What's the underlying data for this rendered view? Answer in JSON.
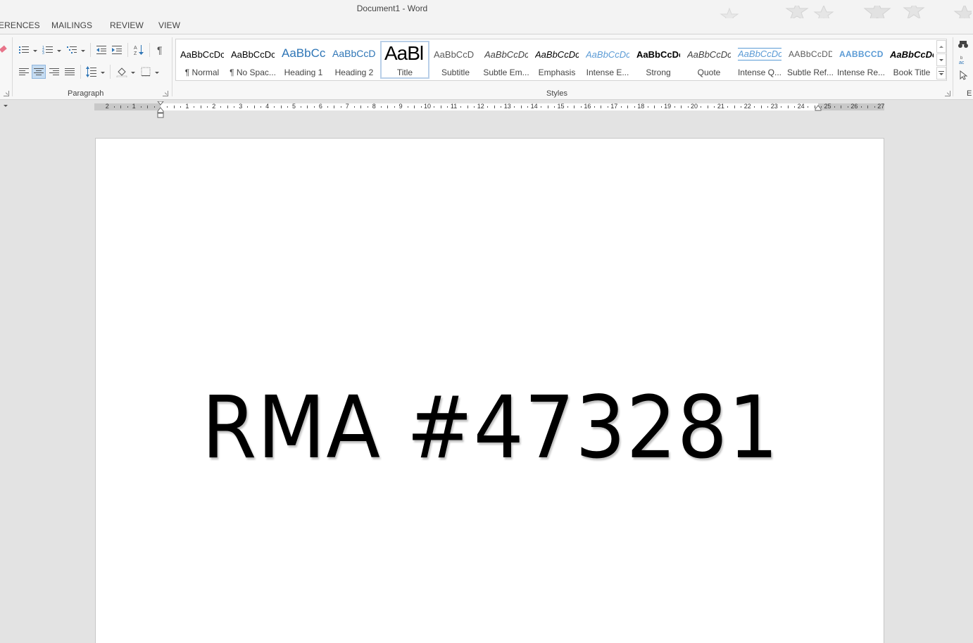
{
  "window": {
    "title": "Document1 - Word"
  },
  "tabs": [
    {
      "label": "ERENCES"
    },
    {
      "label": "MAILINGS"
    },
    {
      "label": "REVIEW"
    },
    {
      "label": "VIEW"
    }
  ],
  "ribbon": {
    "paragraph_group": {
      "label": "Paragraph"
    },
    "styles_group": {
      "label": "Styles",
      "items": [
        {
          "sample": "AaBbCcDc",
          "name": "¶ Normal"
        },
        {
          "sample": "AaBbCcDc",
          "name": "¶ No Spac..."
        },
        {
          "sample": "AaBbCc",
          "name": "Heading 1"
        },
        {
          "sample": "AaBbCcD",
          "name": "Heading 2"
        },
        {
          "sample": "AaBl",
          "name": "Title"
        },
        {
          "sample": "AaBbCcD",
          "name": "Subtitle"
        },
        {
          "sample": "AaBbCcDc",
          "name": "Subtle Em..."
        },
        {
          "sample": "AaBbCcDc",
          "name": "Emphasis"
        },
        {
          "sample": "AaBbCcDc",
          "name": "Intense E..."
        },
        {
          "sample": "AaBbCcDc",
          "name": "Strong"
        },
        {
          "sample": "AaBbCcDc",
          "name": "Quote"
        },
        {
          "sample": "AaBbCcDc",
          "name": "Intense Q..."
        },
        {
          "sample": "AABbCcDD",
          "name": "Subtle Ref..."
        },
        {
          "sample": "AABBCCDD",
          "name": "Intense Re..."
        },
        {
          "sample": "AaBbCcDc",
          "name": "Book Title"
        }
      ],
      "selected": "Title"
    },
    "editing_group": {
      "label": "E"
    }
  },
  "ruler": {
    "left_numbers": [
      "2",
      "1"
    ],
    "numbers": [
      "1",
      "2",
      "3",
      "4",
      "5",
      "6",
      "7",
      "8",
      "9",
      "10",
      "11",
      "12",
      "13",
      "14",
      "15",
      "16",
      "17",
      "18",
      "19",
      "20",
      "21",
      "22",
      "23",
      "24",
      "25",
      "26",
      "27"
    ]
  },
  "document": {
    "body_text": "RMA #473281"
  },
  "colors": {
    "accent_blue": "#2e75b6",
    "selected_border": "#b9cfe8"
  }
}
